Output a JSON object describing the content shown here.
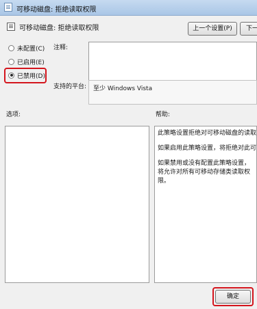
{
  "window": {
    "title": "可移动磁盘: 拒绝读取权限"
  },
  "header": {
    "title": "可移动磁盘: 拒绝读取权限"
  },
  "nav": {
    "prev_label": "上一个设置(P)",
    "next_label": "下一"
  },
  "options": [
    {
      "label": "未配置(C)",
      "checked": false
    },
    {
      "label": "已启用(E)",
      "checked": false
    },
    {
      "label": "已禁用(D)",
      "checked": true
    }
  ],
  "comment": {
    "label": "注释:",
    "value": ""
  },
  "platform": {
    "label": "支持的平台:",
    "value": "至少 Windows Vista"
  },
  "options_panel": {
    "label": "选项:"
  },
  "help_panel": {
    "label": "帮助:",
    "paragraphs": [
      "此策略设置拒绝对可移动磁盘的读取权",
      "如果启用此策略设置，将拒绝对此可移",
      "如果禁用或没有配置此策略设置，将允许对所有可移动存储类读取权限。"
    ]
  },
  "footer": {
    "ok_label": "确定"
  },
  "colors": {
    "highlight": "#d4141c",
    "titlebar": "#b8d1ec"
  }
}
